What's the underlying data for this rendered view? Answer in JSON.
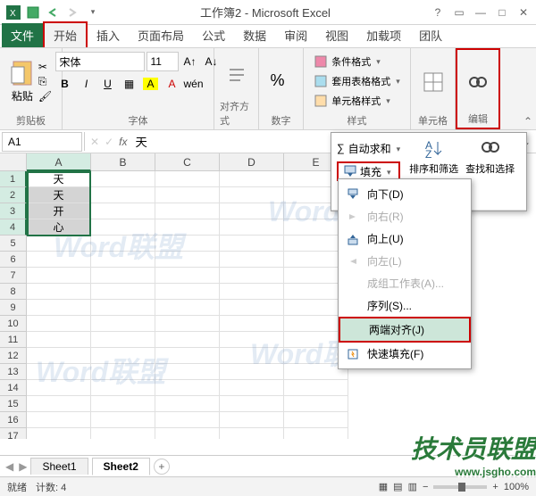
{
  "window": {
    "title": "工作簿2 - Microsoft Excel"
  },
  "tabs": {
    "file": "文件",
    "home": "开始",
    "insert": "插入",
    "pagelayout": "页面布局",
    "formulas": "公式",
    "data": "数据",
    "review": "审阅",
    "view": "视图",
    "addins": "加载项",
    "team": "团队"
  },
  "ribbon": {
    "clipboard": {
      "paste": "粘贴",
      "label": "剪贴板"
    },
    "font": {
      "name": "宋体",
      "size": "11",
      "label": "字体"
    },
    "align": {
      "label": "对齐方式"
    },
    "number": {
      "label": "数字"
    },
    "styles": {
      "cond": "条件格式",
      "table": "套用表格格式",
      "cell": "单元格样式",
      "label": "样式"
    },
    "cells": {
      "label": "单元格"
    },
    "edit": {
      "label": "编辑"
    }
  },
  "formula": {
    "ref": "A1",
    "value": "天"
  },
  "columns": [
    "A",
    "B",
    "C",
    "D",
    "E"
  ],
  "rows_count": 17,
  "cell_data": {
    "A1": "天",
    "A2": "天",
    "A3": "开",
    "A4": "心"
  },
  "dropdown": {
    "autosum": "自动求和",
    "fill": "填充",
    "sort": "排序和筛选",
    "find": "查找和选择"
  },
  "fill_menu": {
    "down": "向下(D)",
    "right": "向右(R)",
    "up": "向上(U)",
    "left": "向左(L)",
    "group": "成组工作表(A)...",
    "series": "序列(S)...",
    "justify": "两端对齐(J)",
    "flash": "快速填充(F)"
  },
  "sheets": {
    "s1": "Sheet1",
    "s2": "Sheet2"
  },
  "status": {
    "mode": "就绪",
    "count_label": "计数:",
    "count": "4",
    "zoom": "100%"
  },
  "logo": {
    "text": "技术员联盟",
    "url": "www.jsgho.com"
  },
  "watermark": "Word联盟"
}
